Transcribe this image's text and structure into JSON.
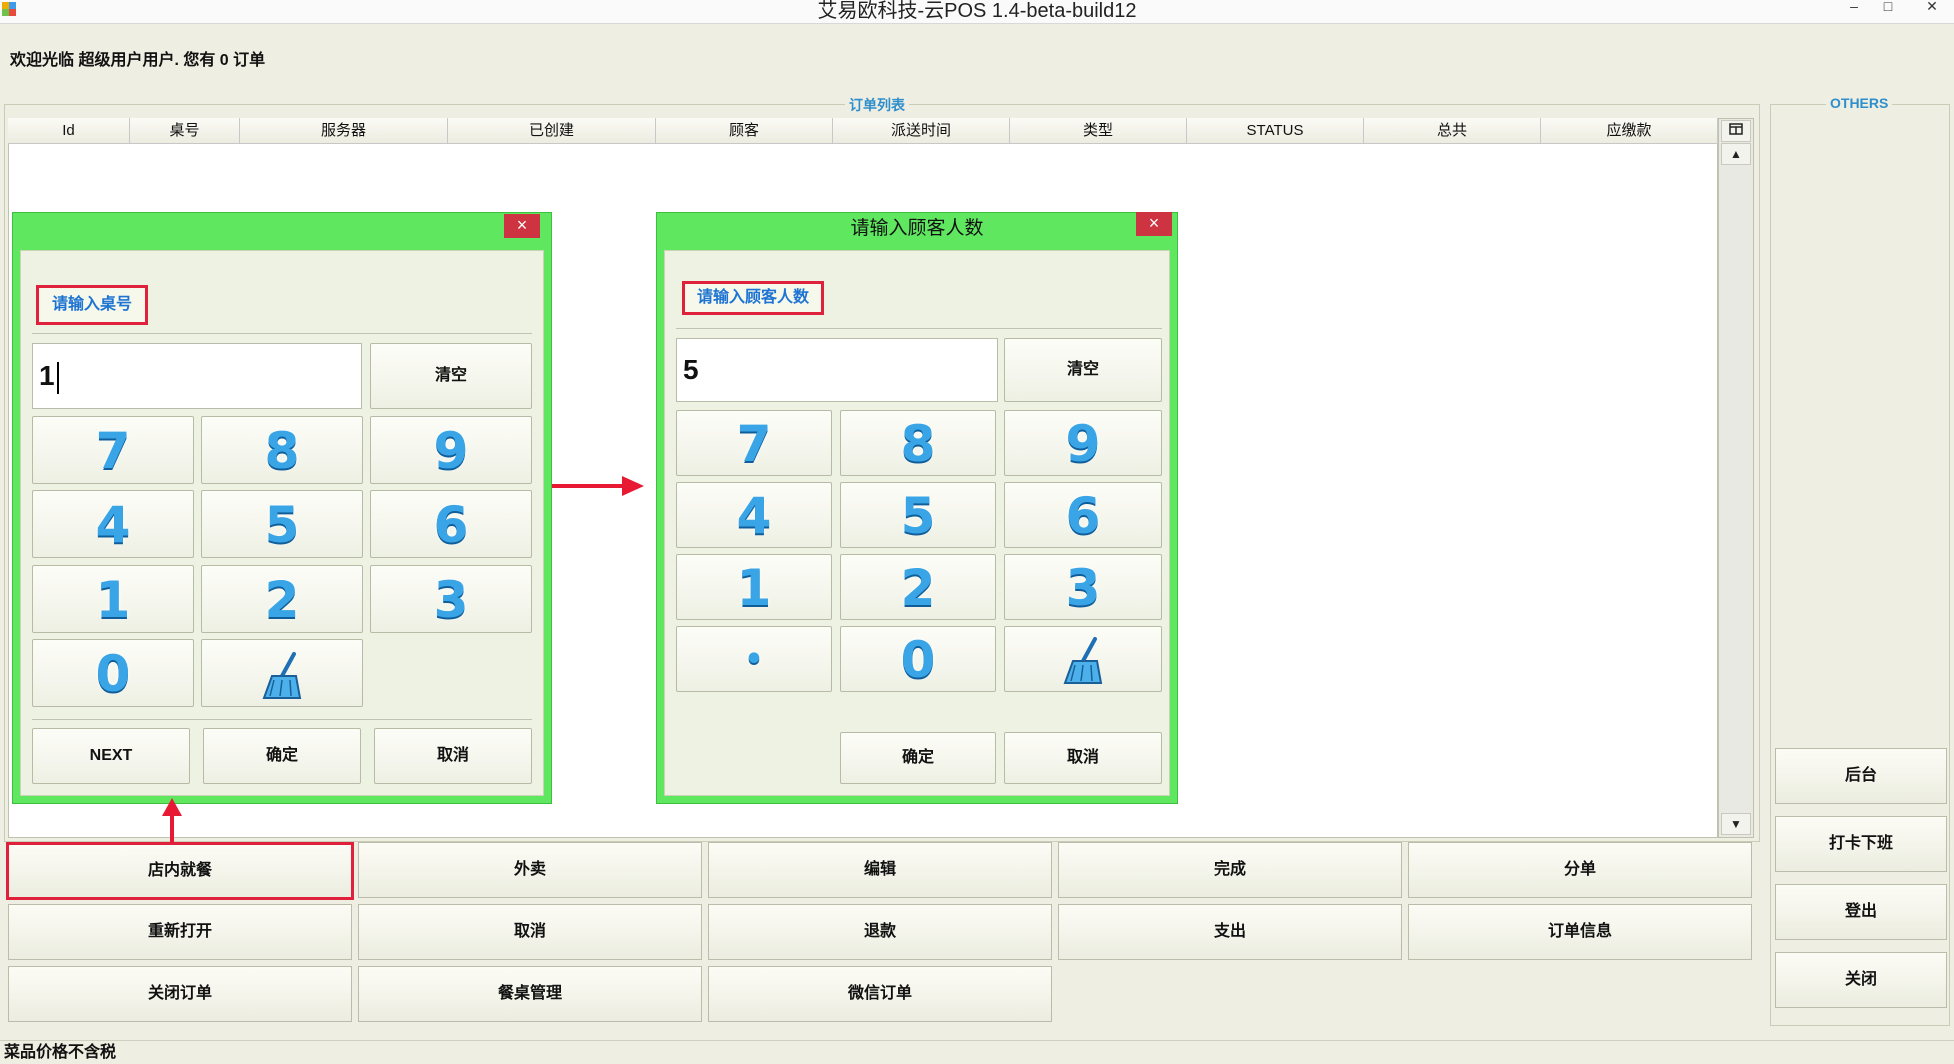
{
  "window": {
    "title": "艾易欧科技-云POS 1.4-beta-build12",
    "minimize": "–",
    "maximize": "□",
    "close": "✕"
  },
  "welcome": "欢迎光临 超级用户用户. 您有 0 订单",
  "order_list": {
    "label": "订单列表",
    "columns": [
      "Id",
      "桌号",
      "服务器",
      "已创建",
      "顾客",
      "派送时间",
      "类型",
      "STATUS",
      "总共",
      "应缴款"
    ],
    "rows": []
  },
  "others": {
    "label": "OTHERS",
    "buttons": [
      "后台",
      "打卡下班",
      "登出",
      "关闭"
    ]
  },
  "table_dialog": {
    "title": "",
    "prompt": "请输入桌号",
    "value": "1",
    "clear": "清空",
    "keys": [
      "7",
      "8",
      "9",
      "4",
      "5",
      "6",
      "1",
      "2",
      "3",
      "0"
    ],
    "next": "NEXT",
    "confirm": "确定",
    "cancel": "取消"
  },
  "guest_dialog": {
    "title": "请输入顾客人数",
    "prompt": "请输入顾客人数",
    "value": "5",
    "clear": "清空",
    "keys": [
      "7",
      "8",
      "9",
      "4",
      "5",
      "6",
      "1",
      "2",
      "3"
    ],
    "dot": "•",
    "zero": "0",
    "confirm": "确定",
    "cancel": "取消"
  },
  "dialog_close": "×",
  "action_buttons": [
    [
      "店内就餐",
      "外卖",
      "编辑",
      "完成",
      "分单"
    ],
    [
      "重新打开",
      "取消",
      "退款",
      "支出",
      "订单信息"
    ],
    [
      "关闭订单",
      "餐桌管理",
      "微信订单"
    ]
  ],
  "status": "菜品价格不含税",
  "icons": {
    "app": "app-icon",
    "broom": "broom-icon",
    "column_chooser": "column-chooser-icon"
  }
}
